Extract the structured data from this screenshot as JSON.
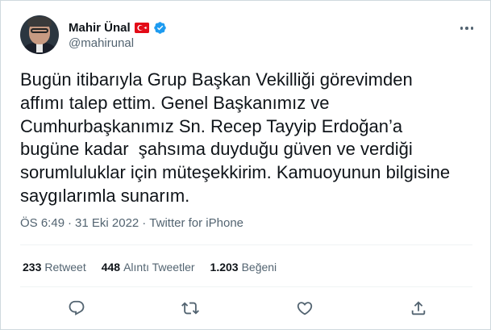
{
  "author": {
    "display_name": "Mahir Ünal",
    "handle": "@mahirunal",
    "flag_icon": "turkey-flag-icon",
    "verified_icon": "verified-badge-icon"
  },
  "tweet": {
    "text": "Bugün itibarıyla Grup Başkan Vekilliği görevimden\naffımı talep ettim. Genel Başkanımız ve\nCumhurbaşkanımız Sn. Recep Tayyip Erdoğan’a\nbugüne kadar  şahsıma duyduğu güven ve verdiği\nsorumluluklar için müteşekkirim. Kamuoyunun bilgisine\nsaygılarımla sunarım.",
    "time": "ÖS 6:49",
    "separator1": "·",
    "date": "31 Eki 2022",
    "separator2": "·",
    "source": "Twitter for iPhone"
  },
  "stats": {
    "retweets": {
      "count": "233",
      "label": "Retweet"
    },
    "quotes": {
      "count": "448",
      "label": "Alıntı Tweetler"
    },
    "likes": {
      "count": "1.203",
      "label": "Beğeni"
    }
  },
  "actions": {
    "reply_icon": "reply-icon",
    "retweet_icon": "retweet-icon",
    "like_icon": "heart-icon",
    "share_icon": "share-icon"
  },
  "colors": {
    "text": "#0f1419",
    "secondary": "#536471",
    "verified": "#1d9bf0",
    "flag": "#e30a17",
    "divider": "#eff3f4"
  }
}
